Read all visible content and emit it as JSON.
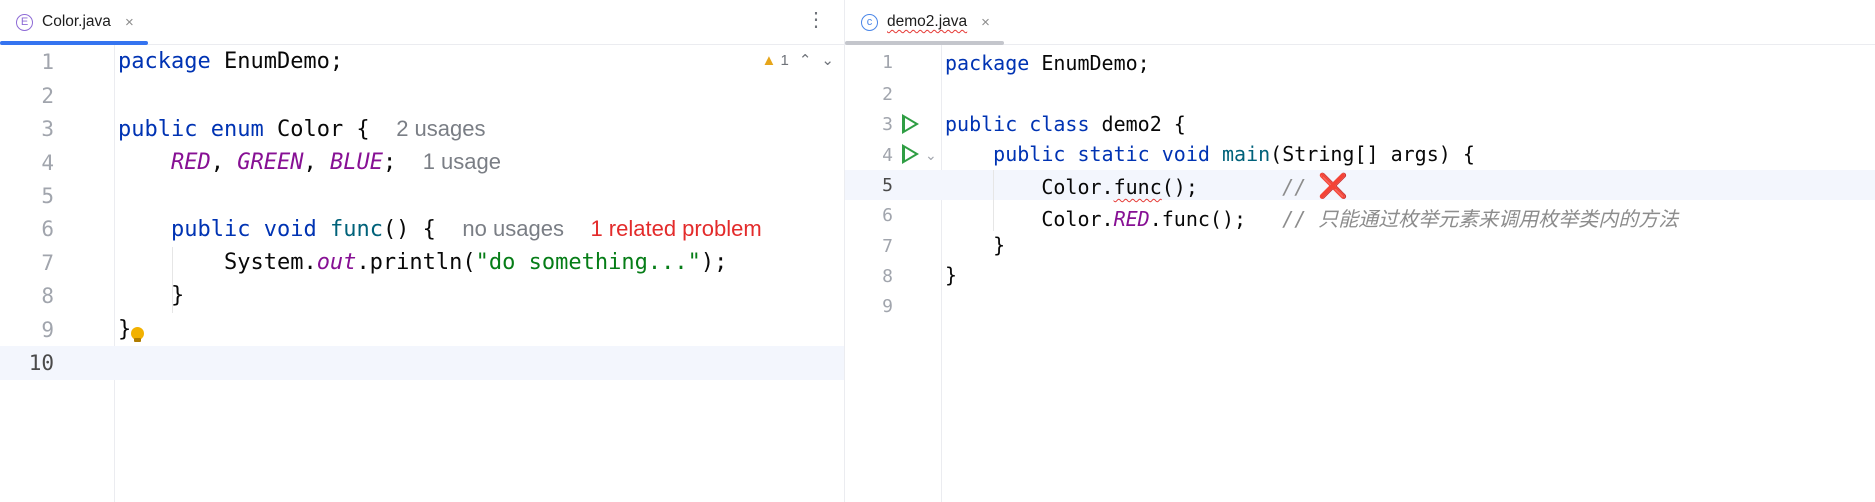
{
  "left": {
    "tab": {
      "label": "Color.java",
      "icon": "enum-icon",
      "close": "×"
    },
    "menu": "⋮",
    "inspection": {
      "count": "1",
      "up": "⌃",
      "down": "⌄"
    },
    "lines": [
      {
        "n": "1"
      },
      {
        "n": "2"
      },
      {
        "n": "3"
      },
      {
        "n": "4"
      },
      {
        "n": "5"
      },
      {
        "n": "6"
      },
      {
        "n": "7"
      },
      {
        "n": "8"
      },
      {
        "n": "9"
      },
      {
        "n": "10"
      }
    ],
    "code": {
      "l1_kw": "package",
      "l1_rest": " EnumDemo;",
      "l3_kw1": "public",
      "l3_kw2": "enum",
      "l3_rest": " Color {",
      "l3_hint": "2 usages",
      "l4_c1": "RED",
      "l4_c2": "GREEN",
      "l4_c3": "BLUE",
      "l4_sep1": ", ",
      "l4_sep2": ", ",
      "l4_end": ";",
      "l4_hint": "1 usage",
      "l6_kw1": "public",
      "l6_kw2": "void",
      "l6_fn": "func",
      "l6_rest": "() {",
      "l6_hint": "no usages",
      "l6_problem": "1 related problem",
      "l7_a": "System.",
      "l7_out": "out",
      "l7_b": ".println(",
      "l7_str": "\"do something...\"",
      "l7_c": ");",
      "l8": "}",
      "l9": "}"
    }
  },
  "right": {
    "tab": {
      "label": "demo2.java",
      "icon": "class-icon",
      "close": "×"
    },
    "lines": [
      {
        "n": "1"
      },
      {
        "n": "2"
      },
      {
        "n": "3"
      },
      {
        "n": "4"
      },
      {
        "n": "5"
      },
      {
        "n": "6"
      },
      {
        "n": "7"
      },
      {
        "n": "8"
      },
      {
        "n": "9"
      }
    ],
    "fold": "⌄",
    "code": {
      "l1_kw": "package",
      "l1_rest": " EnumDemo;",
      "l3_kw1": "public",
      "l3_kw2": "class",
      "l3_rest": " demo2 {",
      "l4_kw1": "public",
      "l4_kw2": "static",
      "l4_kw3": "void",
      "l4_fn": "main",
      "l4_rest": "(String[] args) {",
      "l5_a": "Color.",
      "l5_fn": "func",
      "l5_b": "();",
      "l5_cmt": "//",
      "l5_x": "❌",
      "l6_a": "Color.",
      "l6_red": "RED",
      "l6_b": ".func();",
      "l6_cmt": "// 只能通过枚举元素来调用枚举类内的方法",
      "l7": "}",
      "l8": "}"
    }
  }
}
